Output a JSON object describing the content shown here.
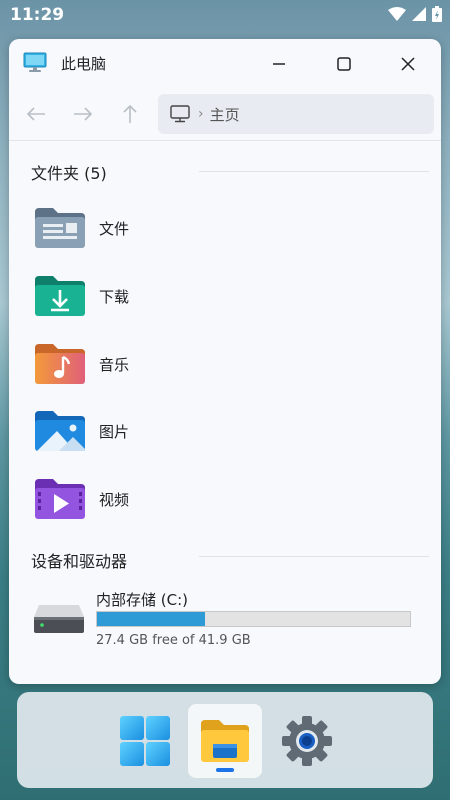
{
  "status_bar": {
    "time": "11:29"
  },
  "window": {
    "title": "此电脑",
    "address": {
      "location": "主页"
    }
  },
  "folders_section": {
    "heading": "文件夹 (5)",
    "items": [
      {
        "label": "文件",
        "icon": "documents-folder-icon"
      },
      {
        "label": "下载",
        "icon": "downloads-folder-icon"
      },
      {
        "label": "音乐",
        "icon": "music-folder-icon"
      },
      {
        "label": "图片",
        "icon": "pictures-folder-icon"
      },
      {
        "label": "视频",
        "icon": "videos-folder-icon"
      }
    ]
  },
  "devices_section": {
    "heading": "设备和驱动器",
    "drive": {
      "name": "内部存储 (C:)",
      "info": "27.4 GB free of 41.9 GB",
      "used_fraction": 0.346
    }
  },
  "taskbar": {
    "items": [
      "start-icon",
      "file-explorer-icon",
      "settings-icon"
    ]
  },
  "colors": {
    "accent": "#2e9bd6",
    "window_bg": "#f7f9fd"
  }
}
